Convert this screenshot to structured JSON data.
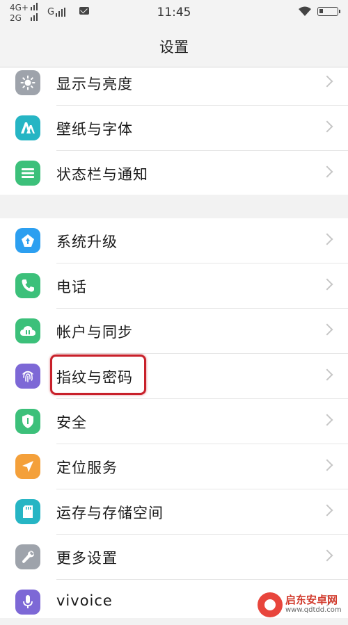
{
  "status_bar": {
    "network_top": "4G+",
    "network_bottom": "2G",
    "network_g": "G",
    "time": "11:45"
  },
  "header": {
    "title": "设置"
  },
  "settings": {
    "group1": [
      {
        "label": "显示与亮度",
        "icon": "brightness-icon",
        "color": "#9ea3ab"
      },
      {
        "label": "壁纸与字体",
        "icon": "font-icon",
        "color": "#26b5c4"
      },
      {
        "label": "状态栏与通知",
        "icon": "notification-list-icon",
        "color": "#3cc07a"
      }
    ],
    "group2": [
      {
        "label": "系统升级",
        "icon": "upgrade-icon",
        "color": "#2c9ff0"
      },
      {
        "label": "电话",
        "icon": "phone-icon",
        "color": "#3cc07a"
      },
      {
        "label": "帐户与同步",
        "icon": "cloud-sync-icon",
        "color": "#3cc07a"
      },
      {
        "label": "指纹与密码",
        "icon": "fingerprint-icon",
        "color": "#7d68d6"
      },
      {
        "label": "安全",
        "icon": "shield-icon",
        "color": "#3cc07a"
      },
      {
        "label": "定位服务",
        "icon": "location-arrow-icon",
        "color": "#f4a03a"
      },
      {
        "label": "运存与存储空间",
        "icon": "storage-card-icon",
        "color": "#26b5c4"
      },
      {
        "label": "更多设置",
        "icon": "wrench-icon",
        "color": "#9ea3ab"
      },
      {
        "label": "vivoice",
        "icon": "microphone-icon",
        "color": "#7d68d6"
      }
    ]
  },
  "watermark": {
    "name": "启东安卓网",
    "url": "www.qdtdd.com"
  }
}
